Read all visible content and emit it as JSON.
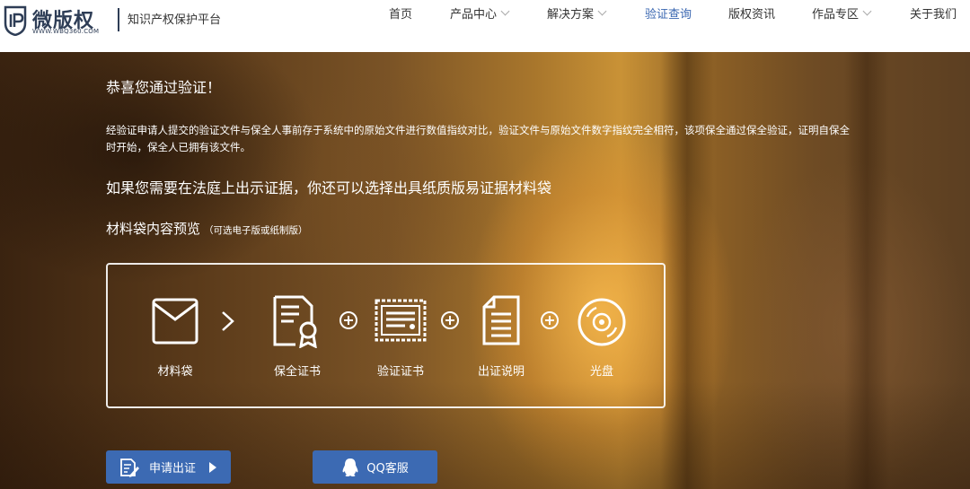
{
  "header": {
    "logo_name": "微版权",
    "logo_url": "WWW.WBQ360.COM",
    "tagline": "知识产权保护平台",
    "nav": [
      {
        "label": "首页",
        "has_dropdown": false,
        "active": false
      },
      {
        "label": "产品中心",
        "has_dropdown": true,
        "active": false
      },
      {
        "label": "解决方案",
        "has_dropdown": true,
        "active": false
      },
      {
        "label": "验证查询",
        "has_dropdown": false,
        "active": true
      },
      {
        "label": "版权资讯",
        "has_dropdown": false,
        "active": false
      },
      {
        "label": "作品专区",
        "has_dropdown": true,
        "active": false
      },
      {
        "label": "关于我们",
        "has_dropdown": false,
        "active": false
      }
    ]
  },
  "hero": {
    "congrats": "恭喜您通过验证！",
    "description": "经验证申请人提交的验证文件与保全人事前存于系统中的原始文件进行数值指纹对比，验证文件与原始文件数字指纹完全相符，该项保全通过保全验证，证明自保全时开始，保全人已拥有该文件。",
    "court_text": "如果您需要在法庭上出示证据，你还可以选择出具纸质版易证据材料袋",
    "preview_title": "材料袋内容预览",
    "preview_note": "（可选电子版或纸制版）"
  },
  "package": {
    "items": [
      {
        "label": "材料袋",
        "icon": "envelope-icon"
      },
      {
        "label": "保全证书",
        "icon": "certificate-icon"
      },
      {
        "label": "验证证书",
        "icon": "verification-certificate-icon"
      },
      {
        "label": "出证说明",
        "icon": "document-icon"
      },
      {
        "label": "光盘",
        "icon": "disc-icon"
      }
    ]
  },
  "buttons": {
    "apply_label": "申请出证",
    "qq_label": "QQ客服"
  },
  "colors": {
    "brand_dark": "#2e3d56",
    "nav_active": "#3a67b1",
    "button_blue": "#3c6ab3"
  }
}
